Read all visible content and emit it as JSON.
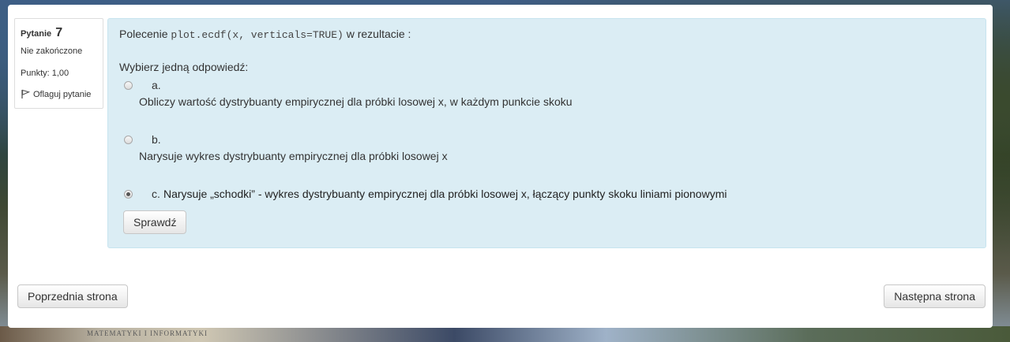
{
  "info": {
    "question_label": "Pytanie",
    "question_number": "7",
    "state": "Nie zakończone",
    "grade": "Punkty: 1,00",
    "flag_label": "Oflaguj pytanie"
  },
  "question": {
    "text_before": "Polecenie ",
    "code": "plot.ecdf(x, verticals=TRUE)",
    "text_after": " w rezultacie :",
    "prompt": "Wybierz jedną odpowiedź:",
    "options": [
      {
        "letter": "a.",
        "text": "Obliczy wartość dystrybuanty empirycznej dla próbki losowej x, w każdym punkcie skoku",
        "selected": false
      },
      {
        "letter": "b.",
        "text": "Narysuje wykres dystrybuanty empirycznej dla próbki losowej x",
        "selected": false
      },
      {
        "letter": "c.",
        "text": "Narysuje „schodki” - wykres dystrybuanty empirycznej dla próbki losowej x, łączący punkty skoku liniami pionowymi",
        "selected": true
      }
    ],
    "check_label": "Sprawdź"
  },
  "nav": {
    "prev_label": "Poprzednia strona",
    "next_label": "Następna strona"
  },
  "background": {
    "sign_text": "MATEMATYKI I INFORMATYKI"
  },
  "colors": {
    "content_bg": "#dbedf4",
    "content_border": "#c7e4ef"
  }
}
